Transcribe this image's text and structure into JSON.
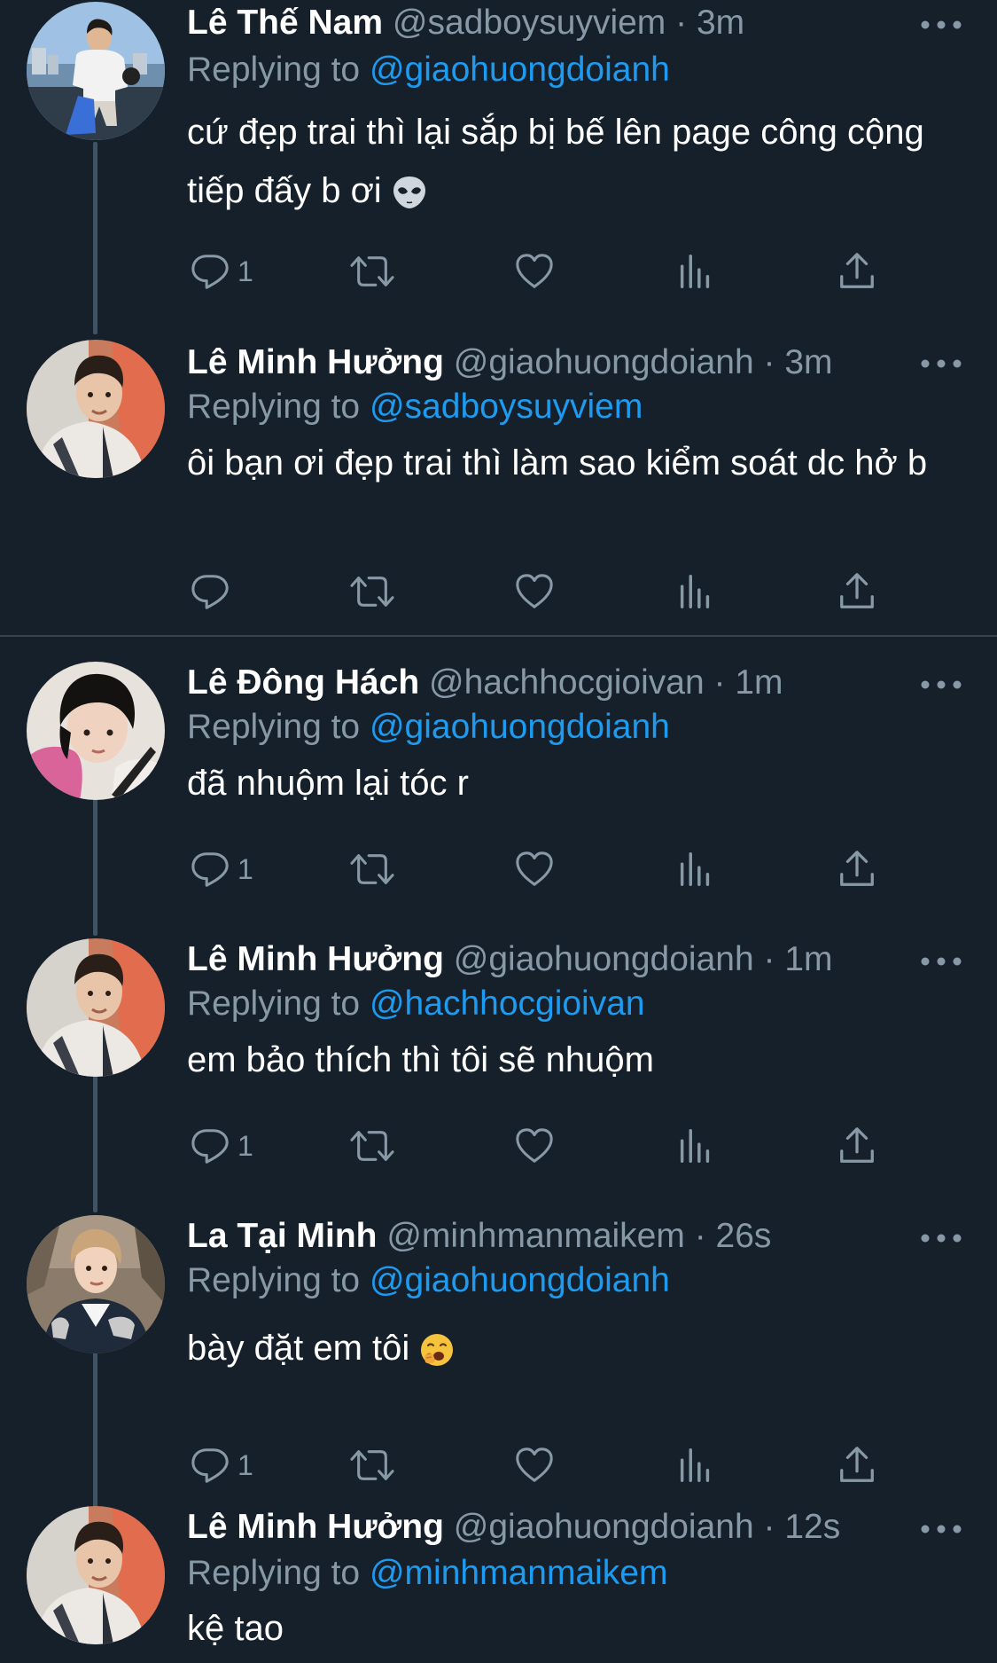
{
  "colors": {
    "background": "#15202b",
    "secondary_text": "#8899a6",
    "mention": "#1d9bf0",
    "thread_line": "#3d5466"
  },
  "tweets": [
    {
      "name": "Lê Thế Nam",
      "handle": "@sadboysuyviem",
      "dot": "·",
      "time": "3m",
      "replying_label": "Replying to",
      "replying_to": "@giaohuongdoianh",
      "text": "cứ đẹp trai thì lại sắp bị bế lên page công cộng tiếp đấy b ơi",
      "emoji": "alien-emoji",
      "reply_count": "1"
    },
    {
      "name": "Lê Minh Hưởng",
      "handle": "@giaohuongdoianh",
      "dot": "·",
      "time": "3m",
      "replying_label": "Replying to",
      "replying_to": "@sadboysuyviem",
      "text": "ôi bạn ơi đẹp trai thì làm sao kiểm soát dc hở b",
      "reply_count": ""
    },
    {
      "name": "Lê Đông Hách",
      "handle": "@hachhocgioivan",
      "dot": "·",
      "time": "1m",
      "replying_label": "Replying to",
      "replying_to": "@giaohuongdoianh",
      "text": "đã nhuộm lại tóc r",
      "reply_count": "1"
    },
    {
      "name": "Lê Minh Hưởng",
      "handle": "@giaohuongdoianh",
      "dot": "·",
      "time": "1m",
      "replying_label": "Replying to",
      "replying_to": "@hachhocgioivan",
      "text": "em bảo thích thì tôi sẽ nhuộm",
      "reply_count": "1"
    },
    {
      "name": "La Tại Minh",
      "handle": "@minhmanmaikem",
      "dot": "·",
      "time": "26s",
      "replying_label": "Replying to",
      "replying_to": "@giaohuongdoianh",
      "text": "bày đặt em tôi",
      "emoji": "yawning-face-emoji",
      "reply_count": "1"
    },
    {
      "name": "Lê Minh Hưởng",
      "handle": "@giaohuongdoianh",
      "dot": "·",
      "time": "12s",
      "replying_label": "Replying to",
      "replying_to": "@minhmanmaikem",
      "text": "kệ tao"
    }
  ]
}
